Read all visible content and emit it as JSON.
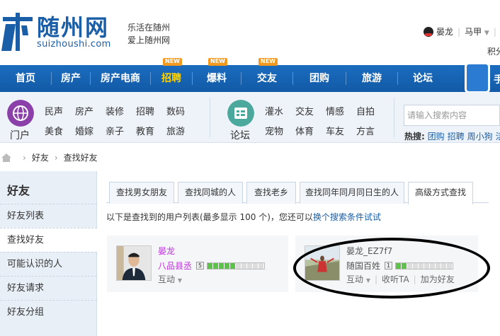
{
  "header": {
    "logo_cn": "随州网",
    "logo_en": "suizhoushi.com",
    "slogan_1": "乐活在随州",
    "slogan_2": "爱上随州网",
    "user_name": "晏龙",
    "user_role": "马甲",
    "score_label": "积分"
  },
  "nav": {
    "items": [
      "首页",
      "房产",
      "房产电商",
      "招聘",
      "爆料",
      "交友",
      "团购",
      "旅游",
      "论坛"
    ],
    "new_badge": "NEW",
    "more_label": "手"
  },
  "categories": {
    "portal_label": "门户",
    "portal_links": [
      "民声",
      "房产",
      "装修",
      "招聘",
      "数码",
      "美食",
      "婚嫁",
      "亲子",
      "教育",
      "旅游"
    ],
    "forum_label": "论坛",
    "forum_links": [
      "灌水",
      "交友",
      "情感",
      "自拍",
      "宠物",
      "体育",
      "车友",
      "方言"
    ],
    "search_placeholder": "请输入搜索内容",
    "hot_label": "热搜:",
    "hot_links": [
      "团购",
      "招聘",
      "周小狗",
      "活"
    ]
  },
  "breadcrumb": [
    "好友",
    "查找好友"
  ],
  "sidebar": {
    "title": "好友",
    "items": [
      "好友列表",
      "查找好友",
      "可能认识的人",
      "好友请求",
      "好友分组"
    ]
  },
  "tabs": [
    "查找男女朋友",
    "查找同城的人",
    "查找老乡",
    "查找同年同月同日生的人",
    "高级方式查找"
  ],
  "info": {
    "text": "以下是查找到的用户列表(最多显示 100 个)，您还可以",
    "link": "换个搜索条件试试"
  },
  "users": [
    {
      "name": "晏龙",
      "title": "八品县丞",
      "level": "5",
      "filled": 5,
      "total": 10,
      "actions": [
        "互动"
      ]
    },
    {
      "name": "晏龙_EZ7f7",
      "title": "随国百姓",
      "level": "1",
      "filled": 2,
      "total": 10,
      "actions": [
        "互动",
        "收听TA",
        "加为好友"
      ]
    }
  ],
  "colors": {
    "primary": "#1a5ea8",
    "nav": "#1b6cbf",
    "level_fill": "#5cc24a",
    "name": "#c22de0",
    "new_badge": "#f39a1e"
  }
}
